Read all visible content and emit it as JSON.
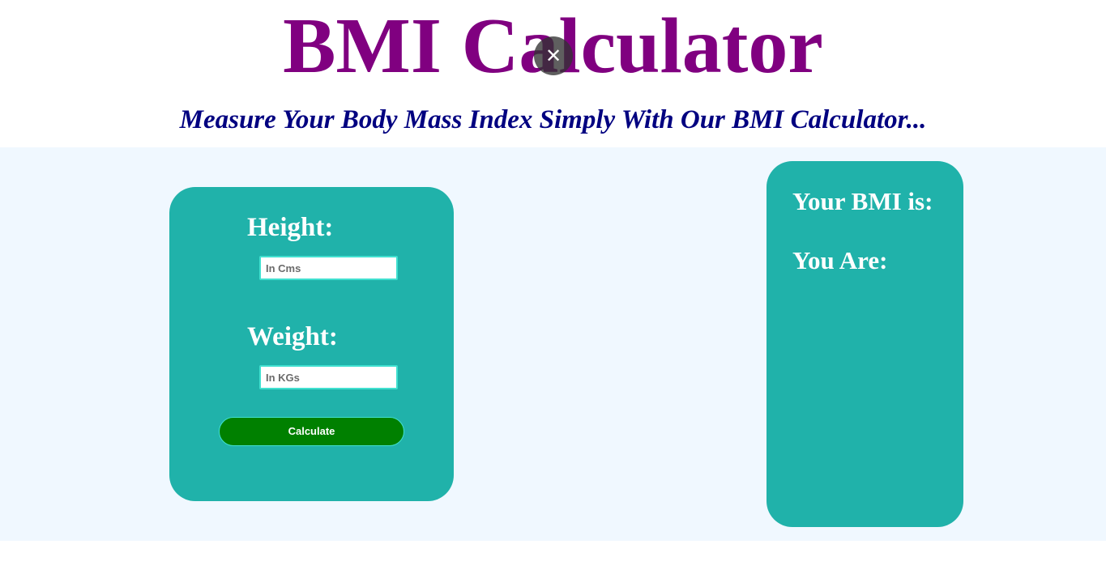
{
  "header": {
    "title": "BMI Calculator",
    "subtitle": "Measure Your Body Mass Index Simply With Our BMI Calculator...",
    "close_glyph": "✕"
  },
  "form": {
    "height_label": "Height:",
    "height_placeholder": "In Cms",
    "height_value": "",
    "weight_label": "Weight:",
    "weight_placeholder": "In KGs",
    "weight_value": "",
    "calculate_label": "Calculate"
  },
  "result": {
    "bmi_label": "Your BMI is:",
    "status_label": "You Are:"
  },
  "colors": {
    "title": "#800080",
    "subtitle": "#000080",
    "band_background": "#f0f8ff",
    "card_background": "#20b2aa",
    "button_background": "#008000",
    "input_border": "#40e0d0"
  },
  "icons": {
    "close": "close-icon"
  }
}
